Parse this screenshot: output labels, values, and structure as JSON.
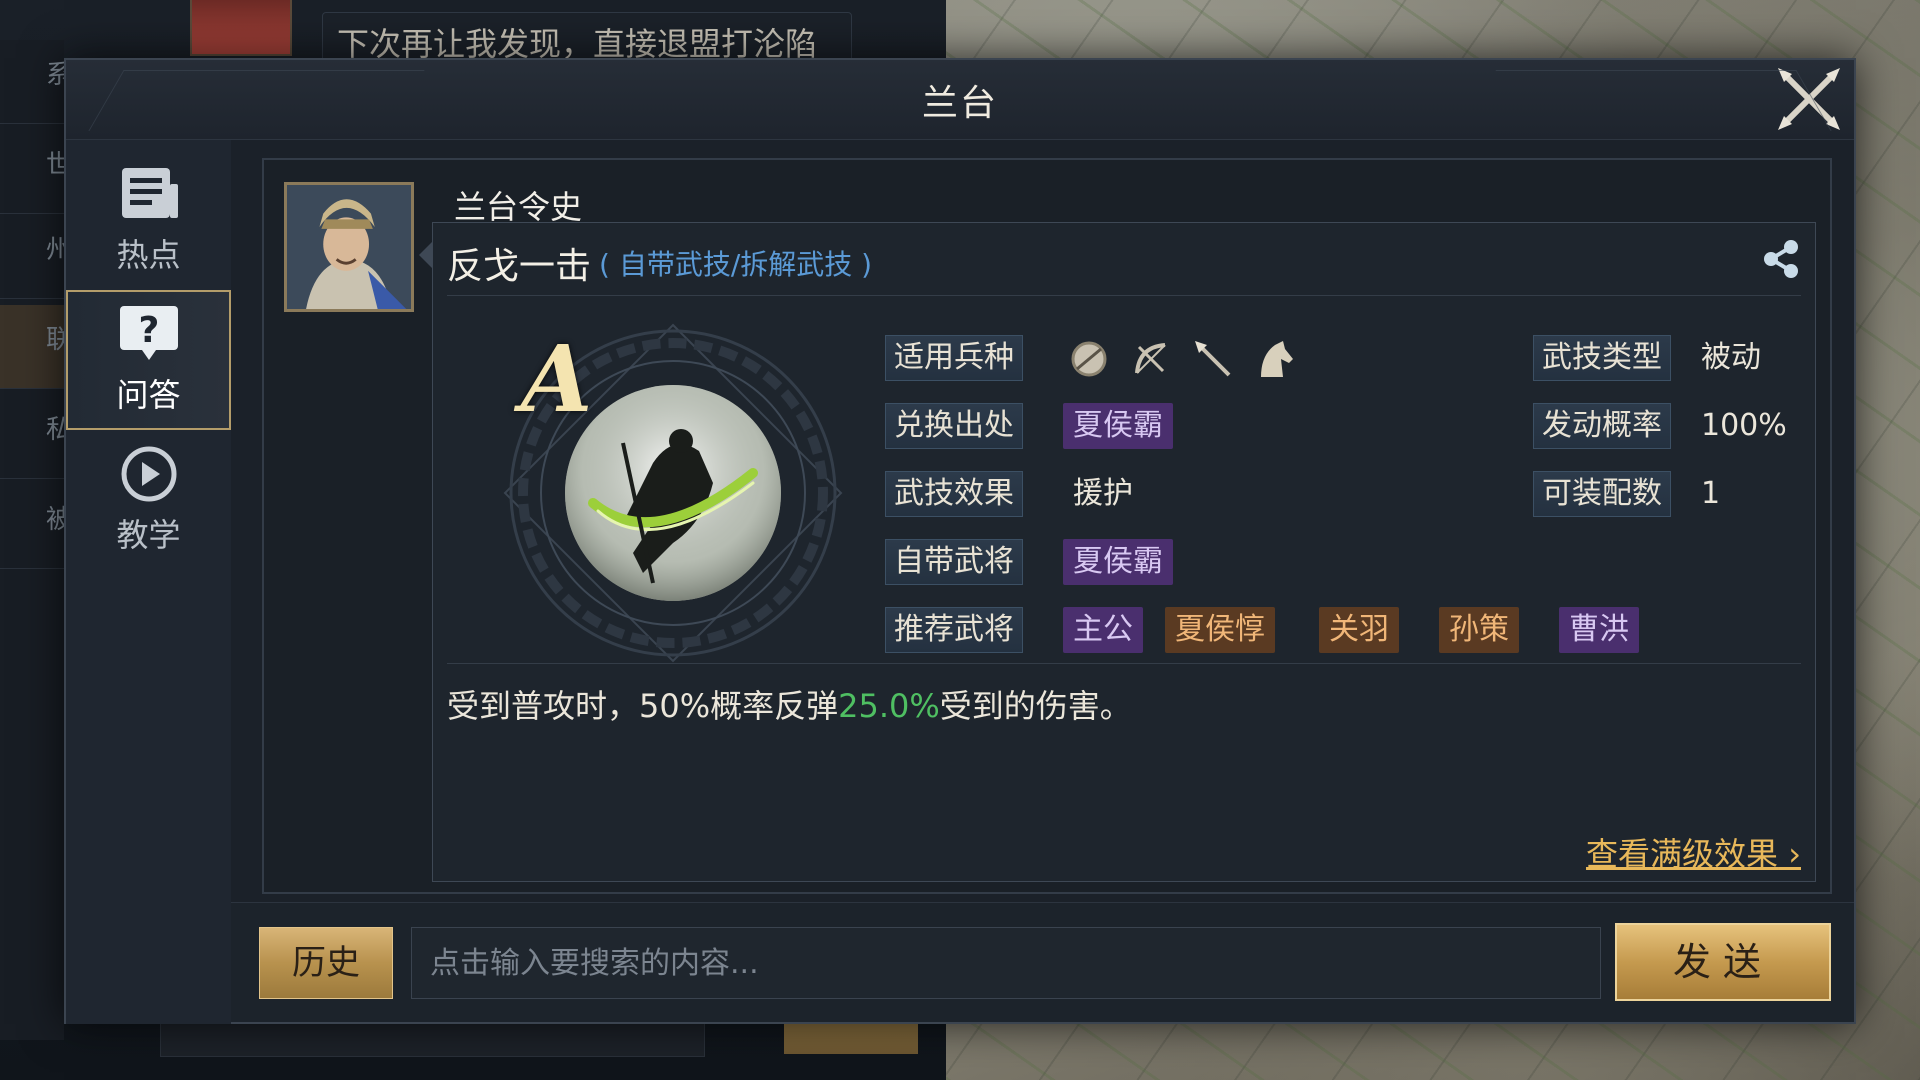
{
  "background": {
    "chat_message": "下次再让我发现，直接退盟打沦陷",
    "side_tabs": [
      "系",
      "世",
      "州",
      "联",
      "私",
      "被"
    ]
  },
  "modal": {
    "title": "兰台"
  },
  "nav": {
    "items": [
      {
        "label": "热点",
        "icon": "news-icon"
      },
      {
        "label": "问答",
        "icon": "question-icon",
        "active": true
      },
      {
        "label": "教学",
        "icon": "play-icon"
      }
    ]
  },
  "answer": {
    "asker": "兰台令史",
    "skill_name": "反戈一击",
    "skill_sub": "( 自带武技/拆解武技 )",
    "grade": "A",
    "rows": {
      "troops_label": "适用兵种",
      "troops": [
        "shield-troop-icon",
        "bow-troop-icon",
        "spear-troop-icon",
        "cavalry-troop-icon"
      ],
      "source_label": "兑换出处",
      "source_value": "夏侯霸",
      "effect_label": "武技效果",
      "effect_value": "援护",
      "owner_label": "自带武将",
      "owner_value": "夏侯霸",
      "recommend_label": "推荐武将",
      "recommend": [
        {
          "name": "主公",
          "color": "purple"
        },
        {
          "name": "夏侯惇",
          "color": "orange"
        },
        {
          "name": "关羽",
          "color": "orange"
        },
        {
          "name": "孙策",
          "color": "orange"
        },
        {
          "name": "曹洪",
          "color": "purple"
        }
      ],
      "type_label": "武技类型",
      "type_value": "被动",
      "rate_label": "发动概率",
      "rate_value": "100%",
      "slots_label": "可装配数",
      "slots_value": "1"
    },
    "description": {
      "prefix": "受到普攻时，50%概率反弹",
      "highlight": "25.0%",
      "suffix": "受到的伤害。"
    },
    "full_effect_link": "查看满级效果"
  },
  "bottom": {
    "history_label": "历史",
    "search_placeholder": "点击输入要搜索的内容...",
    "search_value": "",
    "send_label": "发送"
  },
  "colors": {
    "highlight_green": "#4fbf62",
    "link_gold": "#e8b85a",
    "tag_purple": "#4a2f6e",
    "tag_orange": "#5a3a22",
    "accent_blue": "#5b9ad6"
  }
}
